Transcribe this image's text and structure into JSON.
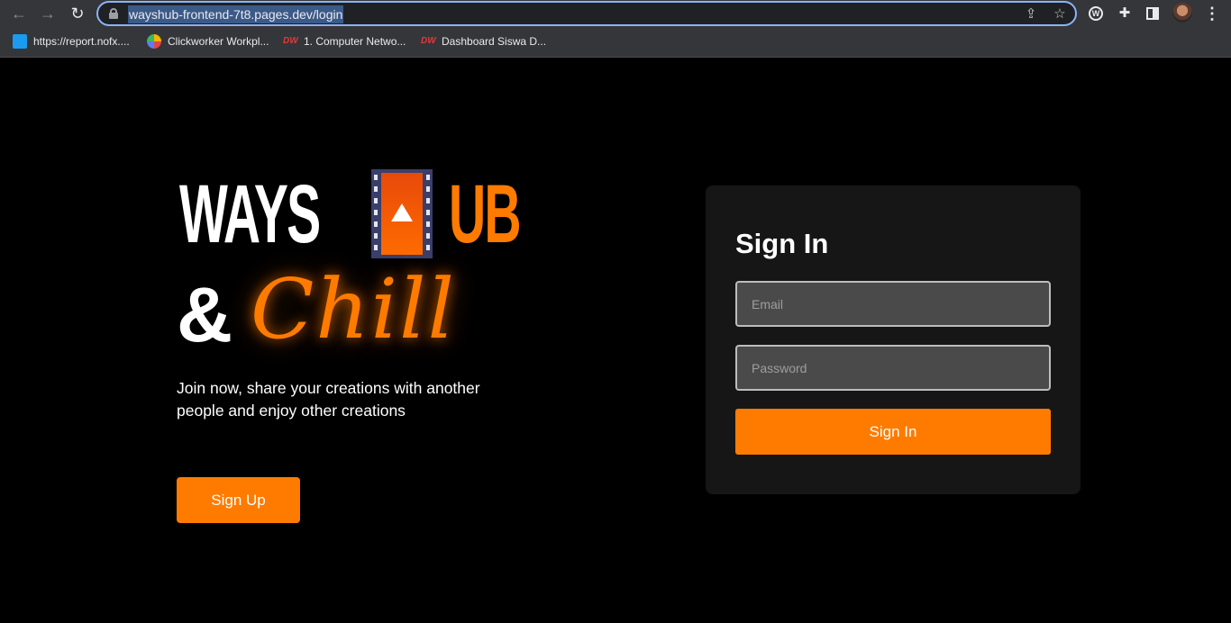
{
  "browser": {
    "url": "wayshub-frontend-7t8.pages.dev/login",
    "bookmarks": [
      {
        "label": "https://report.nofx....",
        "icon": "blue-square-icon"
      },
      {
        "label": "Clickworker Workpl...",
        "icon": "clickworker-icon"
      },
      {
        "label": "1. Computer Netwo...",
        "icon": "dumbways-icon"
      },
      {
        "label": "Dashboard Siswa D...",
        "icon": "dumbways-icon"
      }
    ]
  },
  "hero": {
    "logo_word_left": "WAYS",
    "logo_word_right": "UB",
    "logo_amp": "&",
    "logo_script": "Chill",
    "tagline": "Join now, share your creations with another people and enjoy other creations",
    "signup_label": "Sign Up"
  },
  "signin": {
    "title": "Sign In",
    "email_placeholder": "Email",
    "password_placeholder": "Password",
    "button_label": "Sign In"
  },
  "colors": {
    "accent": "#ff7b00",
    "background": "#000000",
    "card": "#161616"
  }
}
